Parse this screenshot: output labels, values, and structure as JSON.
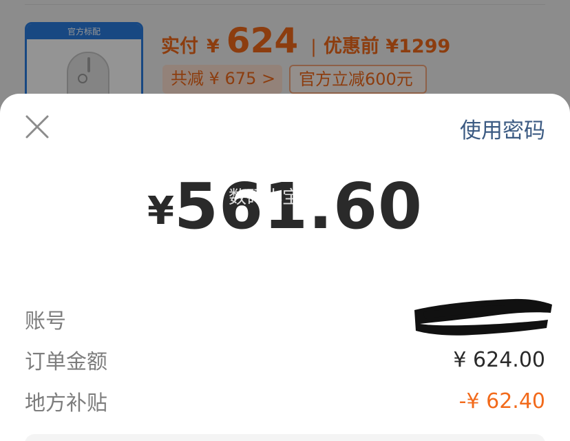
{
  "order_card": {
    "thumb_badge": "官方标配",
    "paid_label": "实付",
    "currency": "¥",
    "paid_amount": "624",
    "separator": "|",
    "before_discount": "优惠前 ¥1299",
    "total_reduction": "共减 ¥ 675 >",
    "official_reduction": "官方立减600元"
  },
  "payment_sheet": {
    "use_password": "使用密码",
    "currency": "¥",
    "amount": "561.60",
    "watermark": "数码小宝-",
    "rows": [
      {
        "label": "账号",
        "value": ""
      },
      {
        "label": "订单金额",
        "value": "¥ 624.00"
      },
      {
        "label": "地方补贴",
        "value": "-¥ 62.40"
      }
    ]
  },
  "colors": {
    "accent_orange": "#f26a1b",
    "link_blue": "#3b5a82",
    "thumb_blue": "#2a7de1"
  },
  "icons": {
    "close": "close-icon"
  }
}
